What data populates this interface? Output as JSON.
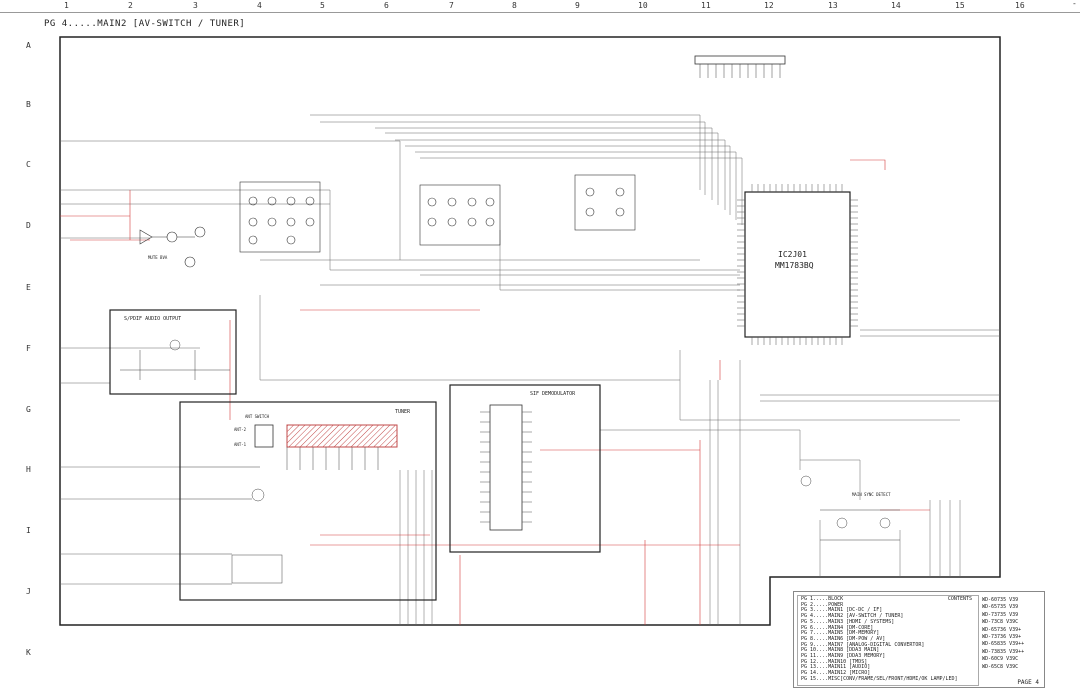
{
  "page": {
    "title": "PG 4.....MAIN2 [AV-SWITCH / TUNER]",
    "corner_mark": "-"
  },
  "grid": {
    "columns": [
      "1",
      "2",
      "3",
      "4",
      "5",
      "6",
      "7",
      "8",
      "9",
      "10",
      "11",
      "12",
      "13",
      "14",
      "15",
      "16"
    ],
    "rows": [
      "A",
      "B",
      "C",
      "D",
      "E",
      "F",
      "G",
      "H",
      "I",
      "J",
      "K"
    ]
  },
  "blocks": {
    "spdif": "S/PDIF AUDIO OUTPUT",
    "tuner": "TUNER",
    "sif": "SIF DEMODULATOR",
    "ant_switch": "ANT SWITCH",
    "main_sync": "MAIN SYNC DETECT",
    "mute": "MUTE BVA"
  },
  "ic": {
    "ref": "IC2J01",
    "part": "MM1783BQ"
  },
  "ant_labels": [
    "ANT-2",
    "ANT-1"
  ],
  "contents": {
    "heading": "CONTENTS",
    "items": [
      "PG 1.....BLOCK",
      "PG 2.....POWER",
      "PG 3.....MAIN1 [DC-DC / IF]",
      "PG 4.....MAIN2 [AV-SWITCH / TUNER]",
      "PG 5.....MAIN3 [HDMI / SYSTEMS]",
      "PG 6.....MAIN4 [DM-CORE]",
      "PG 7.....MAIN5 [DM-MEMORY]",
      "PG 8.....MAIN6 [DM-POW / AV]",
      "PG 9.....MAIN7 [ANALOG-DIGITAL CONVERTOR]",
      "PG 10....MAIN8 [DDA3 MAIN]",
      "PG 11....MAIN9 [DDA3 MEMORY]",
      "PG 12....MAIN10 [TMDS]",
      "PG 13....MAIN11 [AUDIO]",
      "PG 14....MAIN12 [MICRO]",
      "PG 15....MISC[CONV/FRAME/SEL/FRONT/HDMI/OK LAMP/LED]"
    ],
    "models": [
      "WD-60735 V39",
      "WD-65735 V39",
      "WD-73735 V39",
      "WD-73C8  V39C",
      "WD-65736 V39+",
      "WD-73736 V39+",
      "WD-65835 V39++",
      "WD-73835 V39++",
      "WD-60C9  V39C",
      "WD-65C8  V39C"
    ],
    "page_label": "PAGE 4"
  }
}
